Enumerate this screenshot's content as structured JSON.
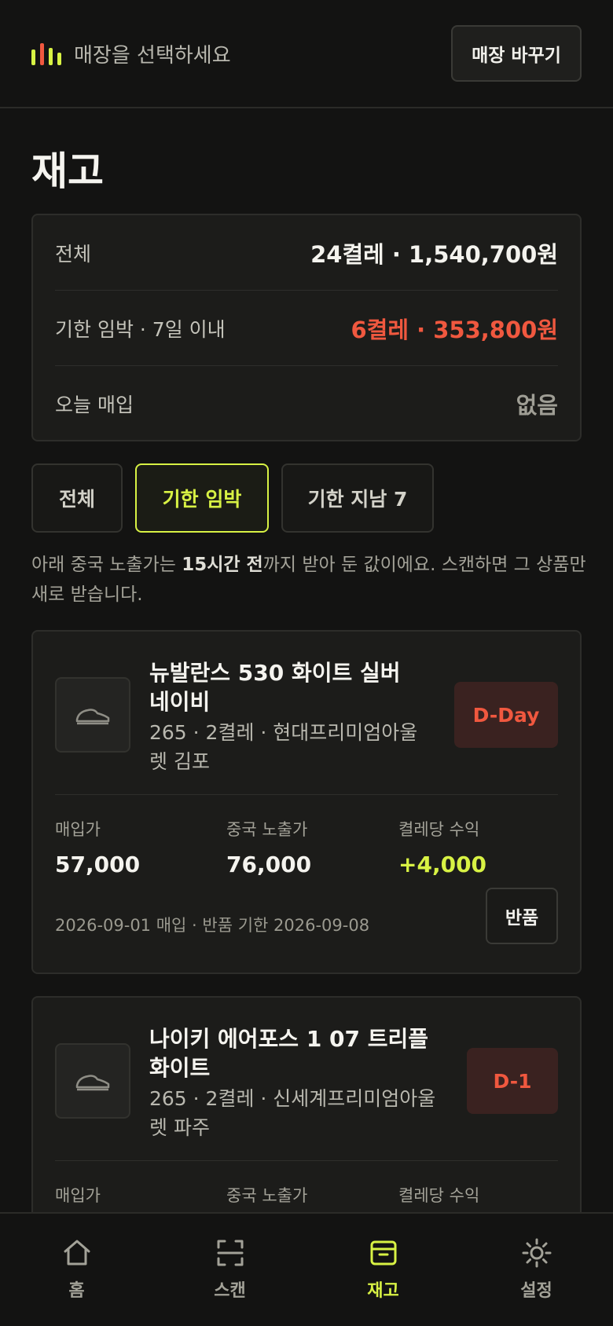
{
  "header": {
    "store_placeholder": "매장을 선택하세요",
    "switch_label": "매장 바꾸기",
    "logo_colors": [
      "#d8f244",
      "#f0583f",
      "#d8f244",
      "#d8f244"
    ]
  },
  "page_title": "재고",
  "summary": [
    {
      "label": "전체",
      "value": "24켤레 · 1,540,700원",
      "tone": "normal"
    },
    {
      "label": "기한 임박 · 7일 이내",
      "value": "6켤레 · 353,800원",
      "tone": "red"
    },
    {
      "label": "오늘 매입",
      "value": "없음",
      "tone": "muted"
    }
  ],
  "tabs": [
    {
      "label": "전체",
      "active": false
    },
    {
      "label": "기한 임박",
      "active": true
    },
    {
      "label": "기한 지남 7",
      "active": false
    }
  ],
  "notice": {
    "before": "아래 중국 노출가는 ",
    "bold": "15시간 전",
    "after": "까지 받아 둔 값이에요. 스캔하면 그 상품만 새로 받습니다."
  },
  "stat_labels": {
    "buy": "매입가",
    "china": "중국 노출가",
    "profit": "켤레당 수익"
  },
  "return_label": "반품",
  "products": [
    {
      "title": "뉴발란스 530 화이트 실버 네이비",
      "meta": "265 · 2켤레 · 현대프리미엄아울렛 김포",
      "dday": "D-Day",
      "buy_price": "57,000",
      "china_price": "76,000",
      "profit": "+4,000",
      "footer": "2026-09-01 매입 · 반품 기한 2026-09-08"
    },
    {
      "title": "나이키 에어포스 1 07 트리플 화이트",
      "meta": "265 · 2켤레 · 신세계프리미엄아울렛 파주",
      "dday": "D-1",
      "buy_price": "",
      "china_price": "",
      "profit": "",
      "footer": ""
    }
  ],
  "nav": [
    {
      "label": "홈",
      "icon": "home-icon",
      "active": false
    },
    {
      "label": "스캔",
      "icon": "scan-icon",
      "active": false
    },
    {
      "label": "재고",
      "icon": "box-icon",
      "active": true
    },
    {
      "label": "설정",
      "icon": "sun-icon",
      "active": false
    }
  ],
  "colors": {
    "accent": "#d8f244",
    "danger": "#f0583f",
    "background": "#131312"
  }
}
